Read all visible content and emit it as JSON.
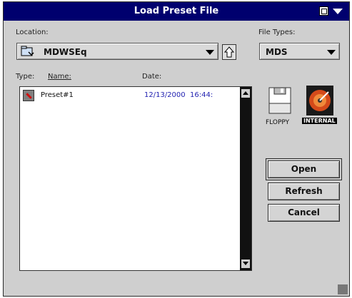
{
  "window": {
    "title": "Load Preset File"
  },
  "location": {
    "label": "Location:",
    "value": "MDWSEq"
  },
  "filetypes": {
    "label": "File Types:",
    "value": "MDS"
  },
  "columns": {
    "type": "Type:",
    "name": "Name:",
    "date": "Date:"
  },
  "files": [
    {
      "name": "Preset#1",
      "date": "12/13/2000  16:44:"
    }
  ],
  "drives": {
    "floppy": "FLOPPY",
    "internal": "INTERNAL"
  },
  "buttons": {
    "open": "Open",
    "refresh": "Refresh",
    "cancel": "Cancel"
  },
  "colors": {
    "titlebar": "#00006e",
    "date_text": "#1f1fb0"
  }
}
